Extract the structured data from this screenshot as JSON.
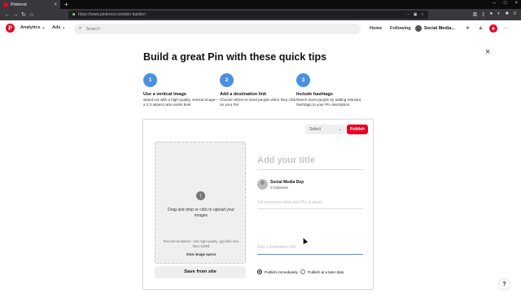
{
  "browser": {
    "tab_title": "Pinterest",
    "tab_close": "×",
    "new_tab": "+",
    "url": "https://www.pinterest.com/pin-builder/",
    "window_controls": [
      "–",
      "□",
      "×"
    ]
  },
  "header": {
    "logo": "P",
    "menu_analytics": "Analytics",
    "menu_ads": "Ads",
    "search_placeholder": "Search",
    "nav_home": "Home",
    "nav_following": "Following",
    "profile_name": "Social Media...",
    "add_symbol": "+"
  },
  "page": {
    "headline": "Build a great Pin with these quick tips",
    "close_symbol": "×",
    "help_symbol": "?"
  },
  "tips": [
    {
      "number": "1",
      "title": "Use a vertical image",
      "description": "Stand out with a high-quality, vertical image—a 2:3 aspect ratio works best"
    },
    {
      "number": "2",
      "title": "Add a destination link",
      "description": "Choose where to send people when they click on your Pin"
    },
    {
      "number": "3",
      "title": "Include hashtags",
      "description": "Reach more people by adding relevant hashtags to your Pin description"
    }
  ],
  "pin_builder": {
    "board_select": "Select",
    "publish_label": "Publish",
    "upload_text": "Drag and drop or click to upload your images",
    "upload_recommendation": "Recommendation: Use high-quality .jpg files less than 32MB",
    "upload_specs": "View image specs",
    "save_from_site": "Save from site",
    "title_placeholder": "Add your title",
    "user_name": "Social Media Dep",
    "user_followers": "0 followers",
    "about_placeholder": "Tell everyone what your Pin is about",
    "link_placeholder": "Add a destination link",
    "publish_now": "Publish immediately",
    "publish_later": "Publish at a later date"
  },
  "colors": {
    "brand_red": "#e60023",
    "tip_blue": "#4a90e2"
  }
}
